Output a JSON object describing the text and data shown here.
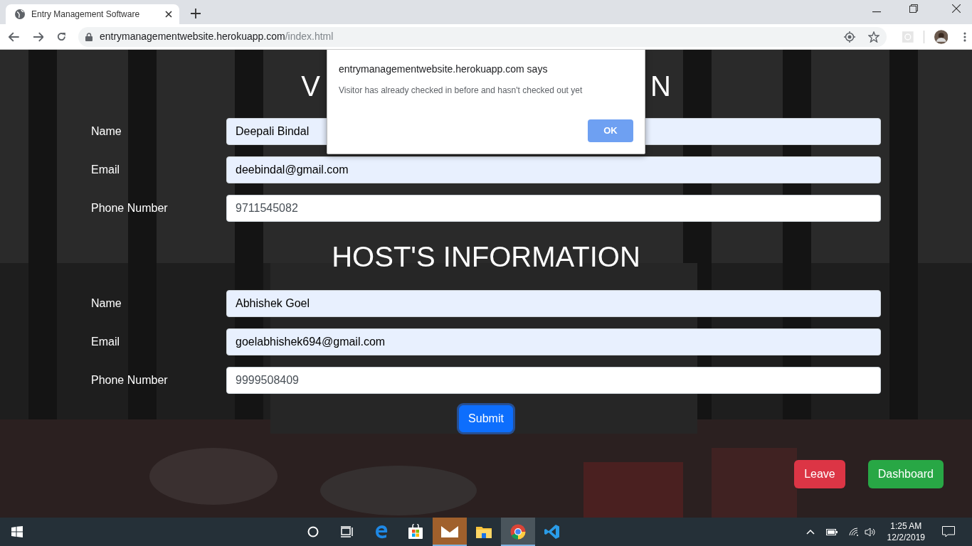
{
  "browser": {
    "tab_title": "Entry Management Software",
    "url_host": "entrymanagementwebsite.herokuapp.com",
    "url_path": "/index.html"
  },
  "visitor_heading": {
    "visible_left": "V",
    "visible_right": "N"
  },
  "visitor_fields": [
    {
      "label": "Name",
      "value": "Deepali Bindal",
      "autofilled": true
    },
    {
      "label": "Email",
      "value": "deebindal@gmail.com",
      "autofilled": true
    },
    {
      "label": "Phone Number",
      "value": "9711545082",
      "autofilled": false
    }
  ],
  "host_heading": "HOST'S INFORMATION",
  "host_fields": [
    {
      "label": "Name",
      "value": "Abhishek Goel",
      "autofilled": true
    },
    {
      "label": "Email",
      "value": "goelabhishek694@gmail.com",
      "autofilled": true
    },
    {
      "label": "Phone Number",
      "value": "9999508409",
      "autofilled": false
    }
  ],
  "submit_button": "Submit",
  "leave_button": "Leave",
  "dashboard_button": "Dashboard",
  "dialog": {
    "title": "entrymanagementwebsite.herokuapp.com says",
    "message": "Visitor has already checked in before and hasn't checked out yet",
    "ok_button": "OK"
  },
  "taskbar": {
    "apps": [
      {
        "kind": "search",
        "active": false
      },
      {
        "kind": "taskview",
        "active": false
      },
      {
        "kind": "edge",
        "active": false
      },
      {
        "kind": "store",
        "active": false
      },
      {
        "kind": "mail",
        "active": true
      },
      {
        "kind": "explorer",
        "active": false
      },
      {
        "kind": "chrome",
        "active": true
      },
      {
        "kind": "vscode",
        "active": false
      }
    ],
    "time": "1:25 AM",
    "date": "12/2/2019"
  }
}
